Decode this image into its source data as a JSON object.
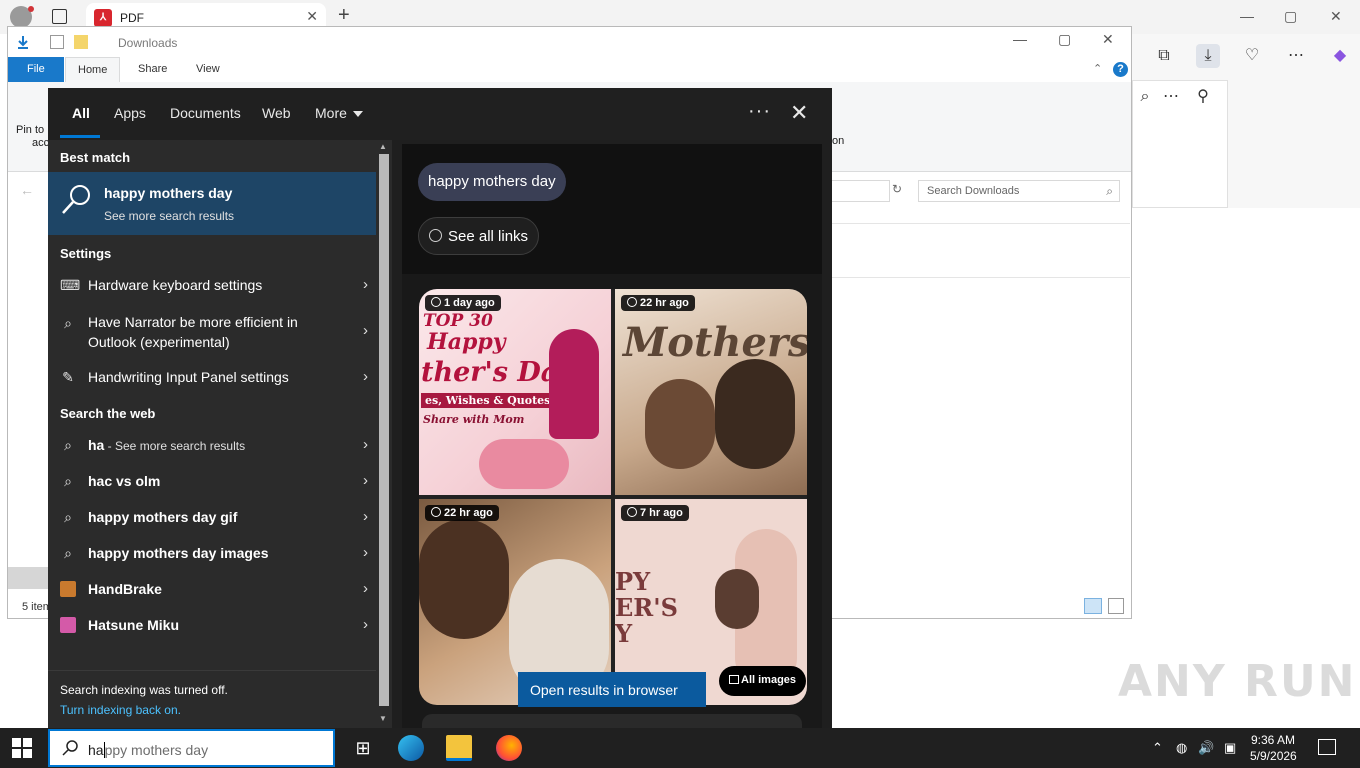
{
  "browser": {
    "tab_title": "PDF",
    "tab_close": "✕",
    "new_tab": "+",
    "window_controls": [
      "—",
      "▢",
      "✕"
    ],
    "toolbar_icons": [
      "tab-icon",
      "download-icon",
      "heart-pulse-icon",
      "more-icon",
      "copilot-icon"
    ],
    "sidebar_icons": [
      "search-icon",
      "more-icon",
      "pin-icon"
    ]
  },
  "explorer": {
    "title": "Downloads",
    "ribbon_tabs": [
      "File",
      "Home",
      "Share",
      "View"
    ],
    "ribbon_partial": {
      "pin_label": "Pin to",
      "access_label": "acc",
      "option_label": "on"
    },
    "search_placeholder": "Search Downloads",
    "status_items": "5 item",
    "help": "?"
  },
  "search_panel": {
    "tabs": [
      "All",
      "Apps",
      "Documents",
      "Web",
      "More"
    ],
    "more_dots": "···",
    "close": "✕",
    "best_match_header": "Best match",
    "best_match": {
      "title": "happy mothers day",
      "subtitle": "See more search results"
    },
    "settings_header": "Settings",
    "settings_items": [
      {
        "label": "Hardware keyboard settings",
        "icon": "keyboard-icon"
      },
      {
        "label": "Have Narrator be more efficient in",
        "label2": "Outlook (experimental)",
        "icon": "narrator-icon"
      },
      {
        "label": "Handwriting Input Panel settings",
        "icon": "pen-icon"
      }
    ],
    "web_header": "Search the web",
    "web_items": [
      {
        "label": "ha",
        "suffix": " - See more search results"
      },
      {
        "label": "hac vs olm"
      },
      {
        "label": "happy mothers day gif"
      },
      {
        "label": "happy mothers day images"
      }
    ],
    "app_items": [
      {
        "label": "HandBrake",
        "icon": "handbrake-icon"
      },
      {
        "label": "Hatsune Miku",
        "icon": "miku-icon"
      }
    ],
    "footer": {
      "text": "Search indexing was turned off.",
      "link": "Turn indexing back on."
    },
    "preview": {
      "query_chip": "happy mothers day",
      "links_chip": "See all links",
      "images": [
        {
          "badge": "1 day ago",
          "lines": [
            "TOP 30",
            "Happy",
            "ther's Day",
            "es, Wishes & Quotes",
            "Share with Mom"
          ]
        },
        {
          "badge": "22 hr ago",
          "lines": [
            "Mothers"
          ]
        },
        {
          "badge": "22 hr ago",
          "lines": []
        },
        {
          "badge": "7 hr ago",
          "lines": [
            "PY",
            "ER'S",
            "Y"
          ]
        }
      ],
      "all_images": "All images",
      "open_browser": "Open results in browser"
    }
  },
  "taskbar": {
    "search_typed": "ha",
    "search_hint": "ppy mothers day",
    "time": "9:36 AM",
    "date": "5/9/2026",
    "tray_icons": [
      "chevron-up-icon",
      "camera-icon",
      "volume-icon",
      "network-icon"
    ],
    "tray_glyphs": [
      "⌃",
      "◍",
      "🔊",
      "▣"
    ]
  },
  "watermark": "ANY RUN",
  "colors": {
    "accent": "#0078d4",
    "best_match_bg": "#1e4566",
    "link": "#4cc2ff",
    "explorer_file_tab": "#1979ca"
  }
}
